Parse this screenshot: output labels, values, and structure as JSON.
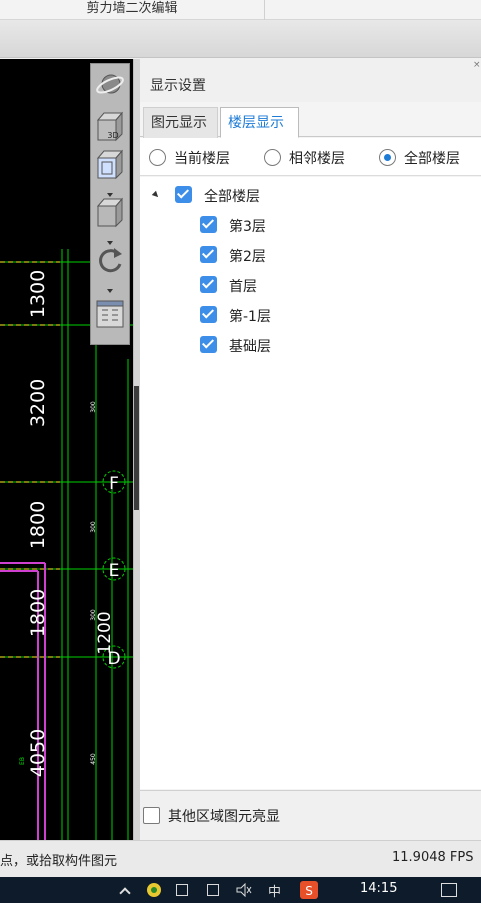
{
  "window": {
    "title": "剪力墙二次编辑"
  },
  "canvas": {
    "dimensions": [
      "1300",
      "3200",
      "1800",
      "1800",
      "4050"
    ],
    "small_labels": [
      "300",
      "300",
      "300",
      "450",
      "EB"
    ],
    "axis_markers": [
      "F",
      "E",
      "D"
    ],
    "overlap_text": "1200",
    "colors": {
      "background": "#000000",
      "grid": "#00e000",
      "red": "#ff2020",
      "magenta": "#d040d0",
      "text": "#ffffff"
    }
  },
  "view_toolbar": {
    "buttons": [
      "dynamic-observe",
      "3d-view",
      "top-view",
      "perspective-view",
      "rotate",
      "layer-settings"
    ],
    "cube_label": "3D"
  },
  "panel": {
    "title": "显示设置",
    "close": "×",
    "tabs": [
      {
        "label": "图元显示",
        "active": false
      },
      {
        "label": "楼层显示",
        "active": true
      }
    ],
    "radios": [
      {
        "label": "当前楼层",
        "checked": false
      },
      {
        "label": "相邻楼层",
        "checked": false
      },
      {
        "label": "全部楼层",
        "checked": true
      }
    ],
    "tree": {
      "root": {
        "label": "全部楼层",
        "checked": true
      },
      "children": [
        {
          "label": "第3层",
          "checked": true
        },
        {
          "label": "第2层",
          "checked": true
        },
        {
          "label": "首层",
          "checked": true
        },
        {
          "label": "第-1层",
          "checked": true
        },
        {
          "label": "基础层",
          "checked": true
        }
      ]
    },
    "footer_option": {
      "label": "其他区域图元亮显",
      "checked": false
    }
  },
  "statusbar": {
    "hint": "点，或拾取构件图元",
    "fps": "11.9048 FPS"
  },
  "taskbar": {
    "time": "14:15",
    "ime": "中",
    "tray_icons": [
      "chevron-up-icon",
      "app-icon",
      "network-icon",
      "display-icon",
      "volume-icon",
      "ime-icon",
      "sogou-icon",
      "notification-icon"
    ]
  },
  "accent": "#1e7bd6"
}
